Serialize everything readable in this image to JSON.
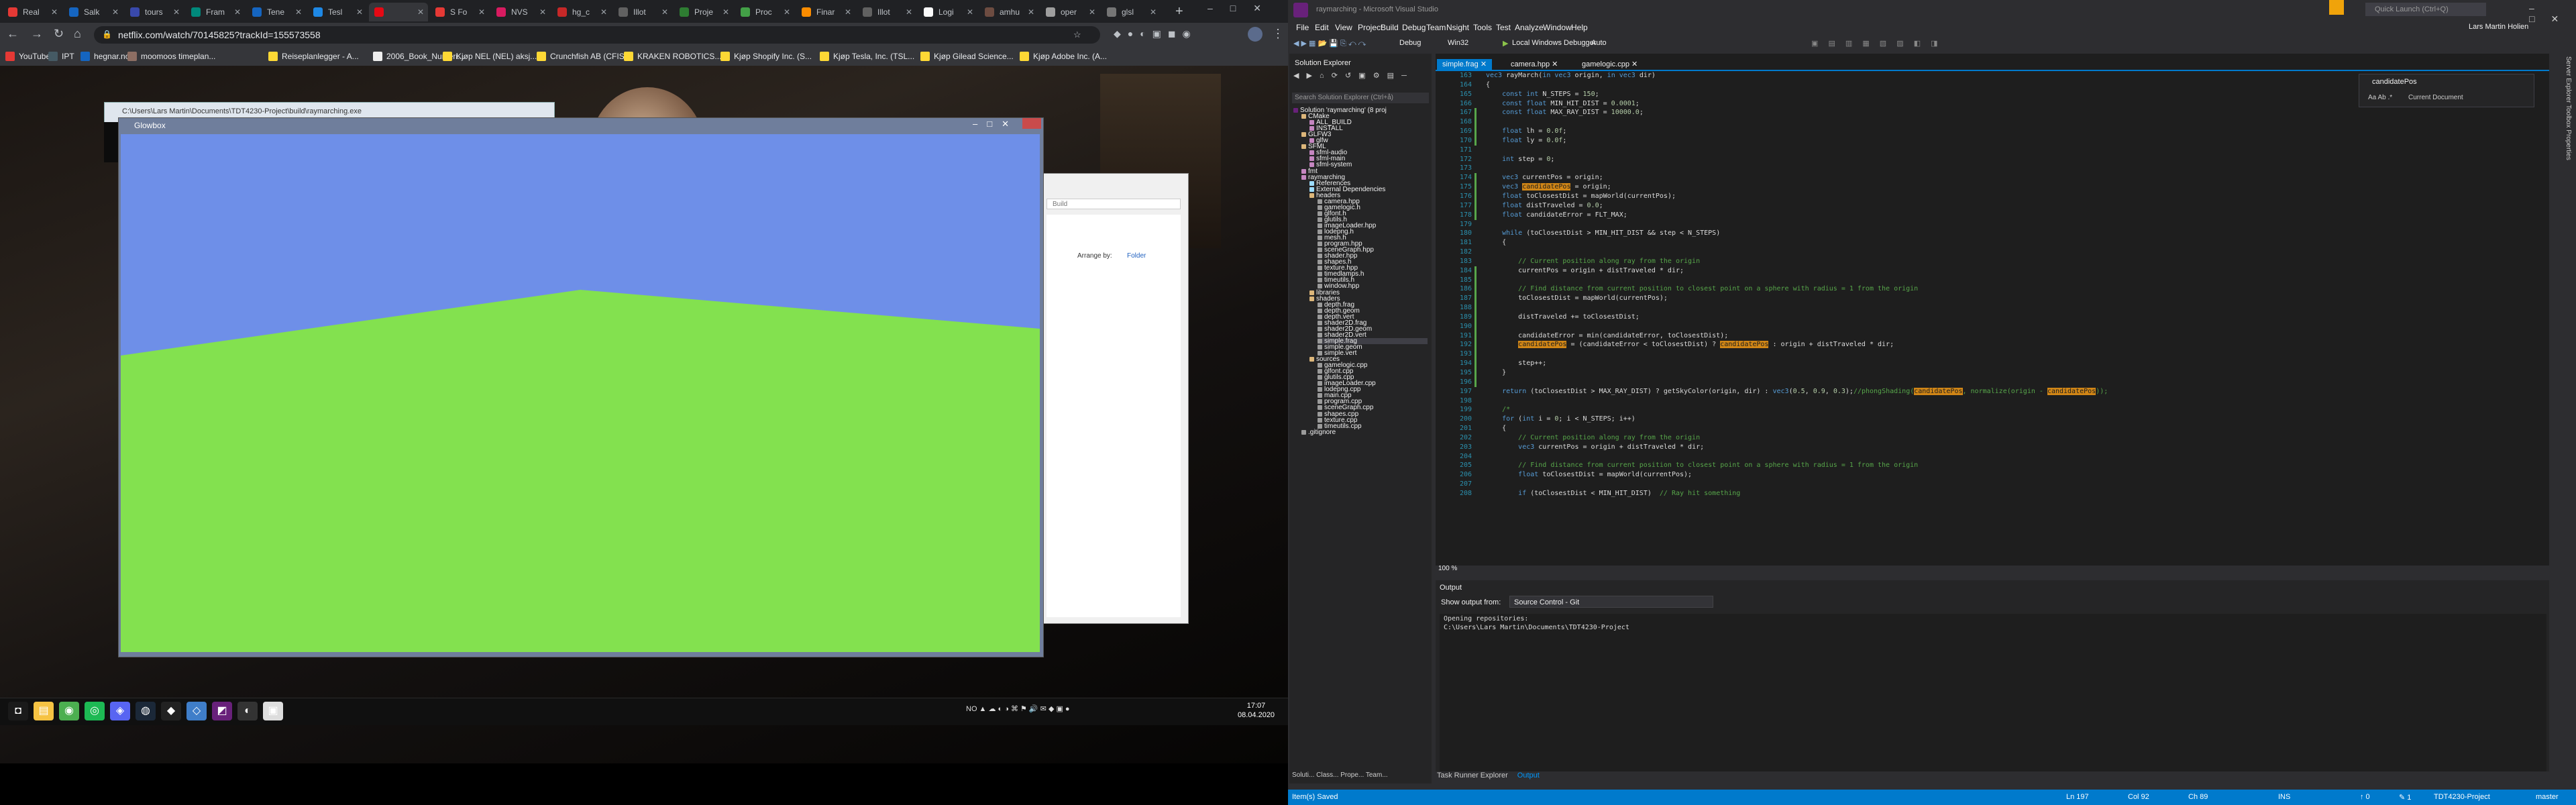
{
  "chrome": {
    "tabs": [
      {
        "label": "Real",
        "color": "#e53935"
      },
      {
        "label": "Salk",
        "color": "#1565c0"
      },
      {
        "label": "tours",
        "color": "#3949ab"
      },
      {
        "label": "Fram",
        "color": "#00897b"
      },
      {
        "label": "Tene",
        "color": "#1565c0"
      },
      {
        "label": "Tesl",
        "color": "#1e88e5"
      },
      {
        "label": "",
        "color": "#e50914"
      },
      {
        "label": "S Fo",
        "color": "#e53935"
      },
      {
        "label": "NVS",
        "color": "#d81b60"
      },
      {
        "label": "hg_c",
        "color": "#c62828"
      },
      {
        "label": "Illot",
        "color": "#616161"
      },
      {
        "label": "Proje",
        "color": "#2e7d32"
      },
      {
        "label": "Proc",
        "color": "#43a047"
      },
      {
        "label": "Finar",
        "color": "#fb8c00"
      },
      {
        "label": "Illot",
        "color": "#616161"
      },
      {
        "label": "Logi",
        "color": "#fafafa"
      },
      {
        "label": "amhu",
        "color": "#6d4c41"
      },
      {
        "label": "oper",
        "color": "#9e9e9e"
      },
      {
        "label": "glsl",
        "color": "#757575"
      }
    ],
    "url": "netflix.com/watch/70145825?trackId=155573558",
    "bookmarks": [
      {
        "label": "YouTube",
        "color": "#e53935"
      },
      {
        "label": "IPT",
        "color": "#455a64"
      },
      {
        "label": "hegnar.no",
        "color": "#1565c0"
      },
      {
        "label": "moomoos timeplan...",
        "color": "#8d6e63"
      },
      {
        "label": "Reiseplanlegger - A...",
        "color": "#fdd835"
      },
      {
        "label": "2006_Book_Numeri...",
        "color": "#eeeeee"
      },
      {
        "label": "Kjøp NEL (NEL) aksj...",
        "color": "#fdd835"
      },
      {
        "label": "Crunchfish AB (CFIS...",
        "color": "#fdd835"
      },
      {
        "label": "KRAKEN ROBOTICS...",
        "color": "#fdd835"
      },
      {
        "label": "Kjøp Shopify Inc. (S...",
        "color": "#fdd835"
      },
      {
        "label": "Kjøp Tesla, Inc. (TSL...",
        "color": "#fdd835"
      },
      {
        "label": "Kjøp Gilead Science...",
        "color": "#fdd835"
      },
      {
        "label": "Kjøp Adobe Inc. (A...",
        "color": "#fdd835"
      }
    ]
  },
  "windows": {
    "console_title": "C:\\Users\\Lars Martin\\Documents\\TDT4230-Project\\build\\raymarching.exe",
    "glowbox_title": "Glowbox",
    "explorer_search": "Build",
    "explorer_arrange_label": "Arrange by:",
    "explorer_arrange_value": "Folder",
    "sky_color": "#6e8fe8",
    "ground_color": "#83e14f"
  },
  "taskbar": {
    "time": "17:07",
    "date": "08.04.2020",
    "lang": "NO",
    "icons": [
      "start",
      "file-explorer",
      "chrome",
      "spotify",
      "discord",
      "steam",
      "unity",
      "visual-studio-code",
      "visual-studio",
      "obs",
      "app"
    ]
  },
  "vs": {
    "title": "raymarching - Microsoft Visual Studio",
    "quick_launch": "Quick Launch (Ctrl+Q)",
    "user": "Lars Martin Holien",
    "menu": [
      "File",
      "Edit",
      "View",
      "Project",
      "Build",
      "Debug",
      "Team",
      "Nsight",
      "Tools",
      "Test",
      "Analyze",
      "Window",
      "Help"
    ],
    "toolbar": {
      "config": "Debug",
      "platform": "Win32",
      "debugger": "Local Windows Debugger",
      "auto": "Auto"
    },
    "solution_explorer": {
      "title": "Solution Explorer",
      "search": "Search Solution Explorer (Ctrl+å)",
      "tree": [
        {
          "t": "Solution 'raymarching' (8 proj",
          "i": 0,
          "c": "#68217a"
        },
        {
          "t": "CMake",
          "i": 1,
          "c": "#dcb67a"
        },
        {
          "t": "ALL_BUILD",
          "i": 2,
          "c": "#c586c0"
        },
        {
          "t": "INSTALL",
          "i": 2,
          "c": "#c586c0"
        },
        {
          "t": "GLFW3",
          "i": 1,
          "c": "#dcb67a"
        },
        {
          "t": "glfw",
          "i": 2,
          "c": "#c586c0"
        },
        {
          "t": "SFML",
          "i": 1,
          "c": "#dcb67a"
        },
        {
          "t": "sfml-audio",
          "i": 2,
          "c": "#c586c0"
        },
        {
          "t": "sfml-main",
          "i": 2,
          "c": "#c586c0"
        },
        {
          "t": "sfml-system",
          "i": 2,
          "c": "#c586c0"
        },
        {
          "t": "fmt",
          "i": 1,
          "c": "#c586c0"
        },
        {
          "t": "raymarching",
          "i": 1,
          "c": "#c586c0"
        },
        {
          "t": "References",
          "i": 2,
          "c": "#9cdcfe"
        },
        {
          "t": "External Dependencies",
          "i": 2,
          "c": "#9cdcfe"
        },
        {
          "t": "headers",
          "i": 2,
          "c": "#dcb67a"
        },
        {
          "t": "camera.hpp",
          "i": 3,
          "c": "#9b9b9b"
        },
        {
          "t": "gamelogic.h",
          "i": 3,
          "c": "#9b9b9b"
        },
        {
          "t": "glfont.h",
          "i": 3,
          "c": "#9b9b9b"
        },
        {
          "t": "glutils.h",
          "i": 3,
          "c": "#9b9b9b"
        },
        {
          "t": "imageLoader.hpp",
          "i": 3,
          "c": "#9b9b9b"
        },
        {
          "t": "lodepng.h",
          "i": 3,
          "c": "#9b9b9b"
        },
        {
          "t": "mesh.h",
          "i": 3,
          "c": "#9b9b9b"
        },
        {
          "t": "program.hpp",
          "i": 3,
          "c": "#9b9b9b"
        },
        {
          "t": "sceneGraph.hpp",
          "i": 3,
          "c": "#9b9b9b"
        },
        {
          "t": "shader.hpp",
          "i": 3,
          "c": "#9b9b9b"
        },
        {
          "t": "shapes.h",
          "i": 3,
          "c": "#9b9b9b"
        },
        {
          "t": "texture.hpp",
          "i": 3,
          "c": "#9b9b9b"
        },
        {
          "t": "timedlamps.h",
          "i": 3,
          "c": "#9b9b9b"
        },
        {
          "t": "timeutils.h",
          "i": 3,
          "c": "#9b9b9b"
        },
        {
          "t": "window.hpp",
          "i": 3,
          "c": "#9b9b9b"
        },
        {
          "t": "libraries",
          "i": 2,
          "c": "#dcb67a"
        },
        {
          "t": "shaders",
          "i": 2,
          "c": "#dcb67a"
        },
        {
          "t": "depth.frag",
          "i": 3,
          "c": "#9b9b9b"
        },
        {
          "t": "depth.geom",
          "i": 3,
          "c": "#9b9b9b"
        },
        {
          "t": "depth.vert",
          "i": 3,
          "c": "#9b9b9b"
        },
        {
          "t": "shader2D.frag",
          "i": 3,
          "c": "#9b9b9b"
        },
        {
          "t": "shader2D.geom",
          "i": 3,
          "c": "#9b9b9b"
        },
        {
          "t": "shader2D.vert",
          "i": 3,
          "c": "#9b9b9b"
        },
        {
          "t": "simple.frag",
          "i": 3,
          "c": "#9b9b9b",
          "sel": true
        },
        {
          "t": "simple.geom",
          "i": 3,
          "c": "#9b9b9b"
        },
        {
          "t": "simple.vert",
          "i": 3,
          "c": "#9b9b9b"
        },
        {
          "t": "sources",
          "i": 2,
          "c": "#dcb67a"
        },
        {
          "t": "gamelogic.cpp",
          "i": 3,
          "c": "#9b9b9b"
        },
        {
          "t": "glfont.cpp",
          "i": 3,
          "c": "#9b9b9b"
        },
        {
          "t": "glutils.cpp",
          "i": 3,
          "c": "#9b9b9b"
        },
        {
          "t": "imageLoader.cpp",
          "i": 3,
          "c": "#9b9b9b"
        },
        {
          "t": "lodepng.cpp",
          "i": 3,
          "c": "#9b9b9b"
        },
        {
          "t": "main.cpp",
          "i": 3,
          "c": "#9b9b9b"
        },
        {
          "t": "program.cpp",
          "i": 3,
          "c": "#9b9b9b"
        },
        {
          "t": "sceneGraph.cpp",
          "i": 3,
          "c": "#9b9b9b"
        },
        {
          "t": "shapes.cpp",
          "i": 3,
          "c": "#9b9b9b"
        },
        {
          "t": "texture.cpp",
          "i": 3,
          "c": "#9b9b9b"
        },
        {
          "t": "timeutils.cpp",
          "i": 3,
          "c": "#9b9b9b"
        },
        {
          "t": ".gitignore",
          "i": 1,
          "c": "#9b9b9b"
        }
      ],
      "bottom_tabs": "Soluti...   Class...   Prope...   Team..."
    },
    "editor_tabs": [
      "simple.frag",
      "camera.hpp",
      "gamelogic.cpp"
    ],
    "line_start": 163,
    "code": [
      "vec3 rayMarch(in vec3 origin, in vec3 dir)",
      "{",
      "    const int N_STEPS = 150;",
      "    const float MIN_HIT_DIST = 0.0001;",
      "    const float MAX_RAY_DIST = 10000.0;",
      "",
      "    float lh = 0.0f;",
      "    float ly = 0.0f;",
      "",
      "    int step = 0;",
      "",
      "    vec3 currentPos = origin;",
      "    vec3 candidatePos = origin;",
      "    float toClosestDist = mapWorld(currentPos);",
      "    float distTraveled = 0.0;",
      "    float candidateError = FLT_MAX;",
      "",
      "    while (toClosestDist > MIN_HIT_DIST && step < N_STEPS)",
      "    {",
      "",
      "        // Current position along ray from the origin",
      "        currentPos = origin + distTraveled * dir;",
      "",
      "        // Find distance from current position to closest point on a sphere with radius = 1 from the origin",
      "        toClosestDist = mapWorld(currentPos);",
      "",
      "        distTraveled += toClosestDist;",
      "",
      "        candidateError = min(candidateError, toClosestDist);",
      "        candidatePos = (candidateError < toClosestDist) ? candidatePos : origin + distTraveled * dir;",
      "",
      "        step++;",
      "    }",
      "",
      "    return (toClosestDist > MAX_RAY_DIST) ? getSkyColor(origin, dir) : vec3(0.5, 0.9, 0.3);//phongShading(candidatePos, normalize(origin - candidatePos));",
      "",
      "    /*",
      "    for (int i = 0; i < N_STEPS; i++)",
      "    {",
      "        // Current position along ray from the origin",
      "        vec3 currentPos = origin + distTraveled * dir;",
      "",
      "        // Find distance from current position to closest point on a sphere with radius = 1 from the origin",
      "        float toClosestDist = mapWorld(currentPos);",
      "",
      "        if (toClosestDist < MIN_HIT_DIST)  // Ray hit something"
    ],
    "find_text": "candidatePos",
    "find_scope": "Current Document",
    "zoom": "100 %",
    "output": {
      "title": "Output",
      "from_label": "Show output from:",
      "from_value": "Source Control - Git",
      "text": "Opening repositories:\nC:\\Users\\Lars Martin\\Documents\\TDT4230-Project"
    },
    "bottom_tabs": [
      "Task Runner Explorer",
      "Output"
    ],
    "side_tabs": "Server Explorer   Toolbox   Properties",
    "status": {
      "left": "Item(s) Saved",
      "ln": "Ln 197",
      "col": "Col 92",
      "ch": "Ch 89",
      "ins": "INS",
      "up": "↑ 0",
      "pencil": "✎ 1",
      "project": "TDT4230-Project",
      "branch": "master"
    }
  }
}
